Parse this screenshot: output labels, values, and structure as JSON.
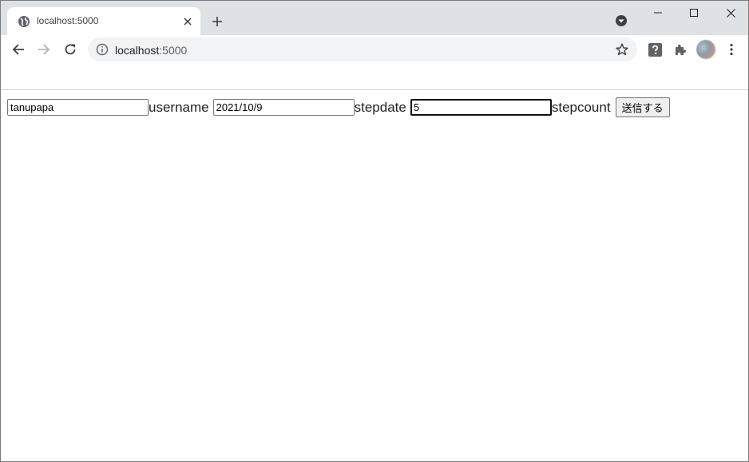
{
  "browser": {
    "tab": {
      "title": "localhost:5000",
      "favicon": "globe-icon"
    },
    "address_bar": {
      "host": "localhost",
      "port": ":5000"
    },
    "colors": {
      "tabstrip": "#dee1e6",
      "omnibox": "#f1f3f4",
      "icon": "#5f6368"
    }
  },
  "form": {
    "username": {
      "value": "tanupapa",
      "label": "username"
    },
    "stepdate": {
      "value": "2021/10/9",
      "label": "stepdate"
    },
    "stepcount": {
      "value": "5",
      "label": "stepcount"
    },
    "submit_label": "送信する"
  }
}
